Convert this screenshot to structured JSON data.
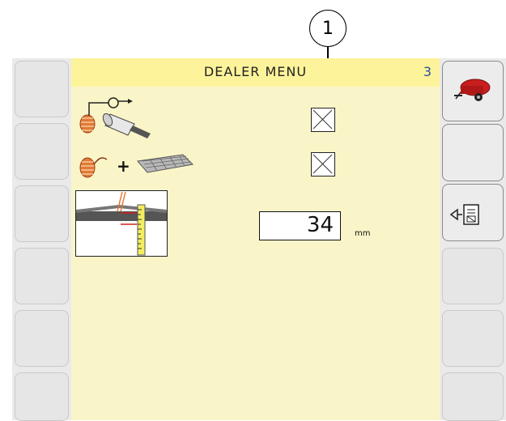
{
  "callout": {
    "label": "1"
  },
  "header": {
    "title": "DEALER MENU",
    "page_number": "3"
  },
  "settings": {
    "net_wrap_checked": false,
    "twine_plus_net_checked": false,
    "net_overlap_value": "34",
    "net_overlap_unit": "mm"
  },
  "icons": {
    "row1": "twine-roll-to-bale-icon",
    "row2": "twine-plus-net-icon",
    "row3": "knife-measurement-icon",
    "right_button_1": "baler-icon",
    "right_button_3": "exit-menu-icon"
  }
}
